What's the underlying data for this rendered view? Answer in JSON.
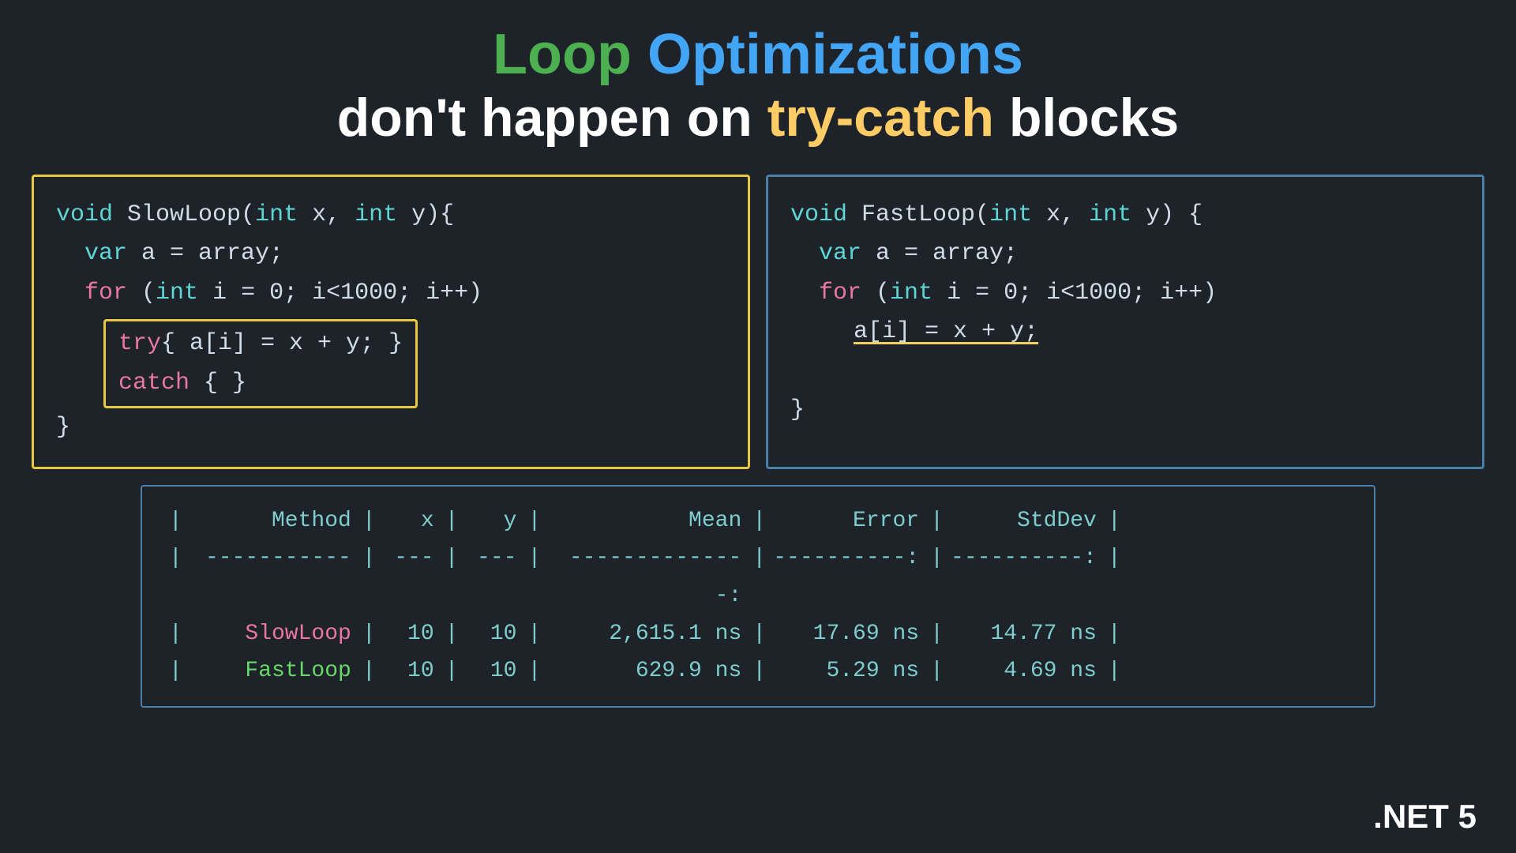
{
  "title": {
    "line1_part1": "Loop",
    "line1_part2": " Optimizations",
    "line2_prefix": "don't happen on ",
    "line2_highlight": "try-catch",
    "line2_suffix": " blocks"
  },
  "code_left": {
    "border_label": "SlowLoop",
    "lines": [
      "void SlowLoop(int x, int y){",
      "  var a = array;",
      "  for (int i = 0; i<1000; i++)",
      "  try{ a[i] = x + y; }",
      "  catch { }",
      "}"
    ]
  },
  "code_right": {
    "border_label": "FastLoop",
    "lines": [
      "void FastLoop(int x, int y) {",
      "  var a = array;",
      "  for (int i = 0; i<1000; i++)",
      "    a[i] = x + y;",
      "",
      "}"
    ]
  },
  "table": {
    "headers": [
      "Method",
      "x",
      "y",
      "Mean",
      "Error",
      "StdDev"
    ],
    "separator": [
      "-----------",
      "---",
      "---",
      "--------------:",
      "----------:",
      "----------:"
    ],
    "rows": [
      {
        "method": "SlowLoop",
        "x": "10",
        "y": "10",
        "mean": "2,615.1 ns",
        "error": "17.69 ns",
        "stddev": "14.77 ns"
      },
      {
        "method": "FastLoop",
        "x": "10",
        "y": "10",
        "mean": "629.9 ns",
        "error": "5.29 ns",
        "stddev": "4.69 ns"
      }
    ]
  },
  "badge": ".NET 5"
}
